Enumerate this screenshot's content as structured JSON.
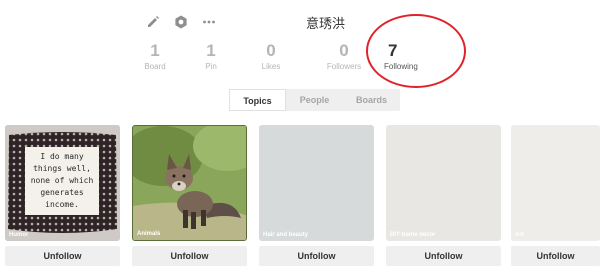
{
  "profile": {
    "name": "意琇洪"
  },
  "header_icons": [
    "edit-icon",
    "settings-icon",
    "more-icon"
  ],
  "stats": [
    {
      "count": "1",
      "label": "Board"
    },
    {
      "count": "1",
      "label": "Pin"
    },
    {
      "count": "0",
      "label": "Likes"
    },
    {
      "count": "0",
      "label": "Followers"
    },
    {
      "count": "7",
      "label": "Following"
    }
  ],
  "highlight_color": "#e0222a",
  "tabs": {
    "topics": "Topics",
    "people": "People",
    "boards": "Boards",
    "active": "Topics"
  },
  "topics": [
    {
      "name": "Humor",
      "button": "Unfollow",
      "pillow_text": [
        "I do many",
        "things well,",
        "none of which",
        "generates",
        "income."
      ]
    },
    {
      "name": "Animals",
      "button": "Unfollow"
    },
    {
      "name": "Hair and beauty",
      "button": "Unfollow",
      "color": "#d6dadb"
    },
    {
      "name": "DIY home decor",
      "button": "Unfollow",
      "color": "#e9e7e3"
    },
    {
      "name": "Art",
      "button": "Unfollow",
      "color": "#efedea"
    }
  ]
}
